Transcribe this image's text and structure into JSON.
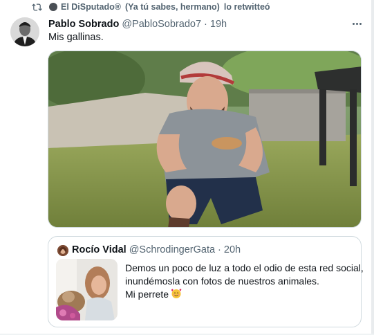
{
  "retweet": {
    "icon": "retweet-icon",
    "user": "El DiSputado",
    "badge": "®",
    "note": "(Ya tú sabes, hermano)",
    "action": "lo retwitteó"
  },
  "tweet": {
    "author_name": "Pablo Sobrado",
    "author_handle": "@PabloSobrado7",
    "separator": "·",
    "time": "19h",
    "text": "Mis gallinas."
  },
  "quote": {
    "author_name": "Rocío Vidal",
    "author_handle": "@SchrodingerGata",
    "separator": "·",
    "time": "20h",
    "lines": [
      "Demos un poco de luz a todo el odio de esta red social,",
      "inundémosla con fotos de nuestros animales.",
      "Mi perrete"
    ],
    "emoji": "smiling-face-with-hearts"
  },
  "icons": [
    "retweet-icon",
    "more-options-icon",
    "smiling-face-with-hearts-emoji"
  ],
  "colors": {
    "text_primary": "#0f1419",
    "text_secondary": "#536471",
    "border": "#cfd9de"
  }
}
